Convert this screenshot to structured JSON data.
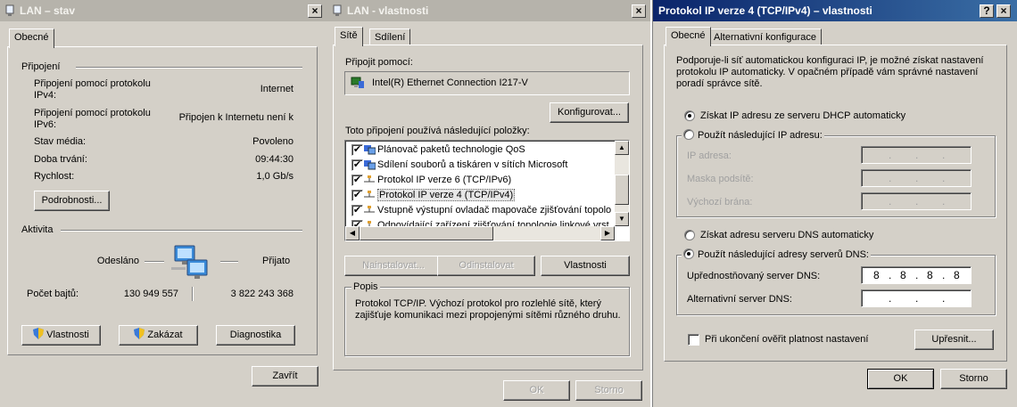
{
  "status_window": {
    "title": "LAN – stav",
    "close_glyph": "×",
    "tab_general": "Obecné",
    "section_connection": "Připojení",
    "rows": [
      {
        "label_1": "Připojení pomocí protokolu",
        "label_2": "IPv4:",
        "value": "Internet"
      },
      {
        "label_1": "Připojení pomocí protokolu",
        "label_2": "IPv6:",
        "value": "Připojen k Internetu není k"
      },
      {
        "label_1": "Stav média:",
        "value": "Povoleno"
      },
      {
        "label_1": "Doba trvání:",
        "value": "09:44:30"
      },
      {
        "label_1": "Rychlost:",
        "value": "1,0 Gb/s"
      }
    ],
    "details_button": "Podrobnosti...",
    "section_activity": "Aktivita",
    "sent_label": "Odesláno",
    "received_label": "Přijato",
    "bytes_label": "Počet bajtů:",
    "bytes_sent": "130 949 557",
    "bytes_received": "3 822 243 368",
    "properties_button": "Vlastnosti",
    "disable_button": "Zakázat",
    "diagnose_button": "Diagnostika",
    "close_button": "Zavřít"
  },
  "properties_window": {
    "title": "LAN - vlastnosti",
    "close_glyph": "×",
    "tab_network": "Sítě",
    "tab_sharing": "Sdílení",
    "connect_using_label": "Připojit pomocí:",
    "adapter_name": "Intel(R) Ethernet Connection I217-V",
    "configure_button": "Konfigurovat...",
    "items_label": "Toto připojení používá následující položky:",
    "items": [
      {
        "label": "Plánovač paketů technologie QoS",
        "checked": "✔"
      },
      {
        "label": "Sdílení souborů a tiskáren v sítích Microsoft",
        "checked": "✔"
      },
      {
        "label": "Protokol IP verze 6 (TCP/IPv6)",
        "checked": "✔"
      },
      {
        "label": "Protokol IP verze 4 (TCP/IPv4)",
        "checked": "✔"
      },
      {
        "label": "Vstupně výstupní ovladač mapovače zjišťování topolo",
        "checked": "✔"
      },
      {
        "label": "Odpovídající zařízení zjišťování topologie linkové vrst",
        "checked": "✔"
      }
    ],
    "install_button": "Nainstalovat...",
    "uninstall_button": "Odinstalovat",
    "properties_button": "Vlastnosti",
    "description_legend": "Popis",
    "description_text_1": "Protokol TCP/IP. Výchozí protokol pro rozlehlé sítě, který",
    "description_text_2": "zajišťuje komunikaci mezi propojenými sítěmi různého druhu.",
    "ok_button": "OK",
    "cancel_button": "Storno"
  },
  "ipv4_window": {
    "title": "Protokol IP verze 4 (TCP/IPv4) – vlastnosti",
    "help_glyph": "?",
    "close_glyph": "×",
    "tab_general": "Obecné",
    "tab_alternate": "Alternativní konfigurace",
    "intro_1": "Podporuje-li síť automatickou konfiguraci IP, je možné získat nastavení",
    "intro_2": "protokolu IP automaticky. V opačném případě vám správné nastavení",
    "intro_3": "poradí správce sítě.",
    "auto_ip_label": "Získat IP adresu ze serveru DHCP automaticky",
    "manual_ip_label": "Použít následující IP adresu:",
    "ip_address_label": "IP adresa:",
    "subnet_label": "Maska podsítě:",
    "gateway_label": "Výchozí brána:",
    "auto_dns_label": "Získat adresu serveru DNS automaticky",
    "manual_dns_label": "Použít následující adresy serverů DNS:",
    "preferred_dns_label": "Upřednostňovaný server DNS:",
    "preferred_dns_octets": [
      "8",
      "8",
      "8",
      "8"
    ],
    "alternate_dns_label": "Alternativní server DNS:",
    "dot": ".",
    "validate_label": "Při ukončení ověřit platnost nastavení",
    "advanced_button": "Upřesnit...",
    "ok_button": "OK",
    "cancel_button": "Storno"
  }
}
